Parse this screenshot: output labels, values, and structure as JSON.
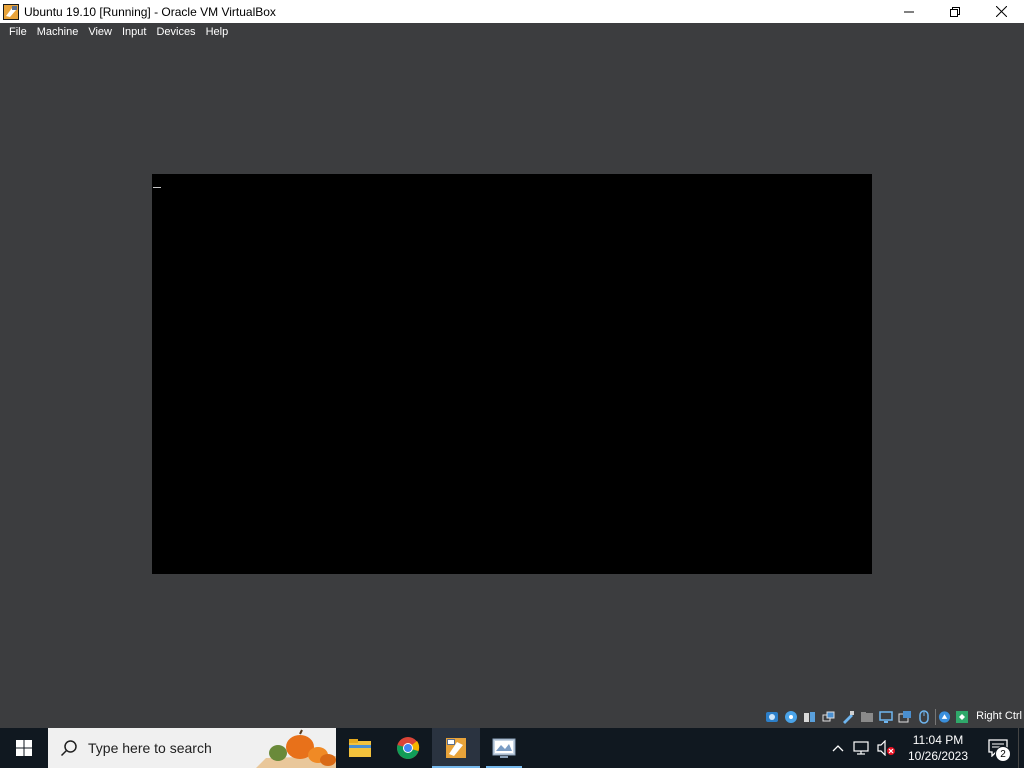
{
  "window": {
    "title": "Ubuntu 19.10 [Running] - Oracle VM VirtualBox",
    "controls": [
      "minimize-icon",
      "restore-icon",
      "close-icon"
    ]
  },
  "menu": {
    "items": [
      {
        "label": "File"
      },
      {
        "label": "Machine"
      },
      {
        "label": "View"
      },
      {
        "label": "Input"
      },
      {
        "label": "Devices"
      },
      {
        "label": "Help"
      }
    ]
  },
  "vm": {
    "screen_color": "#000000",
    "background_color": "#3c3d3f"
  },
  "statusbar": {
    "icons": [
      "hard-disk-icon",
      "optical-drive-icon",
      "audio-icon",
      "network-icon",
      "usb-icon",
      "shared-folders-icon",
      "display-icon",
      "video-capture-icon",
      "mouse-integration-icon",
      "cpu-icon",
      "keyboard-icon"
    ],
    "host_key": "Right Ctrl"
  },
  "taskbar": {
    "search_placeholder": "Type here to search",
    "apps": [
      {
        "name": "file-explorer-icon"
      },
      {
        "name": "chrome-icon"
      },
      {
        "name": "virtualbox-manager-icon"
      },
      {
        "name": "virtualbox-vm-icon"
      }
    ],
    "clock_time": "11:04 PM",
    "clock_date": "10/26/2023",
    "notification_count": "2"
  }
}
